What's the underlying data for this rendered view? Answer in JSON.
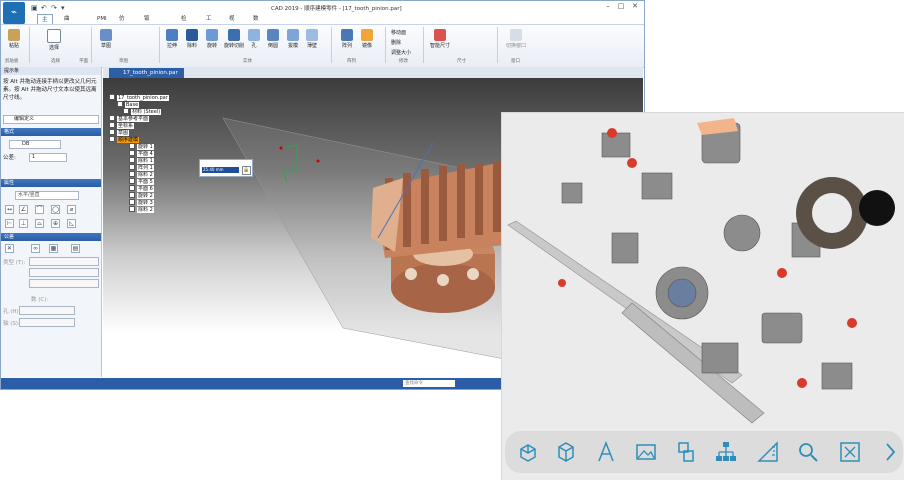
{
  "window": {
    "title": "CAD 2019 - 顺序建模零件 - [17_tooth_pinion.par]",
    "controls": [
      "–",
      "□",
      "✕"
    ]
  },
  "ribbon_tabs": [
    "主页",
    "曲面处理",
    "PMI",
    "仿真",
    "钣金设计",
    "检查",
    "工具",
    "视图",
    "数据管理"
  ],
  "ribbon": {
    "groups": [
      "剪贴板",
      "选择",
      "平面",
      "草图",
      "实体",
      "阵列",
      "修改",
      "尺寸",
      "窗口"
    ],
    "buttons": {
      "paste": "粘贴",
      "select": "选择",
      "sketch": "草图",
      "extrude": "拉伸",
      "revolve": "旋转",
      "hole": "孔",
      "round": "倒圆",
      "thin": "薄壁",
      "pattern": "阵列",
      "mirror": "镜像",
      "move_face": "移动面",
      "delete": "删除",
      "resize": "调整大小",
      "smart_dim": "智能尺寸",
      "switch_window": "切换窗口",
      "cut": "除料",
      "loft": "旋转切削",
      "draft": "拔模",
      "shell": "抽壳",
      "add_body": "添加实体",
      "assist": "辅助"
    }
  },
  "left_panel": {
    "tool_label": "提示条",
    "hint_text": "按 Alt 并拖动连接手柄以更改父几何元素。按 Alt 并拖动尺寸文本以使其远离尺寸线。",
    "edit_def": "编辑定义",
    "format_header": "格式",
    "format_value": "DB",
    "std_label": "公差:",
    "std_value": "1",
    "props_header": "属性",
    "orient_value": "水平/竖直",
    "tolerance_header": "公差",
    "type_label": "类型 (T):",
    "hole_label": "孔 (H):",
    "axis_label": "轴 (S):",
    "count_label": "数 (C):"
  },
  "document": {
    "tab": "17_tooth_pinion.par"
  },
  "tree": [
    {
      "label": "17_tooth_pinion.par",
      "sel": false
    },
    {
      "label": "Base",
      "sel": false
    },
    {
      "label": "材料 (Steel)",
      "sel": false
    },
    {
      "label": "基本参考平面",
      "sel": false
    },
    {
      "label": "坐标系",
      "sel": false
    },
    {
      "label": "草图",
      "sel": false
    },
    {
      "label": "顺序建模",
      "sel": true
    },
    {
      "label": "旋转 1",
      "sel": false
    },
    {
      "label": "平面 4",
      "sel": false
    },
    {
      "label": "除料 1",
      "sel": false
    },
    {
      "label": "阵列 1",
      "sel": false
    },
    {
      "label": "除料 2",
      "sel": false
    },
    {
      "label": "平面 5",
      "sel": false
    },
    {
      "label": "平面 6",
      "sel": false
    },
    {
      "label": "旋转 2",
      "sel": false
    },
    {
      "label": "旋转 3",
      "sel": false
    },
    {
      "label": "除料 2",
      "sel": false
    }
  ],
  "dimension": {
    "value": "25.40 mm"
  },
  "status": {
    "search_placeholder": "查找命令"
  },
  "viewer_toolbar": {
    "icons": [
      "cube-explode-icon",
      "box-icon",
      "text-icon",
      "image-icon",
      "parts-icon",
      "tree-icon",
      "measure-icon",
      "zoom-icon",
      "fit-icon",
      "next-icon"
    ],
    "accent": "#2f8eb9"
  }
}
